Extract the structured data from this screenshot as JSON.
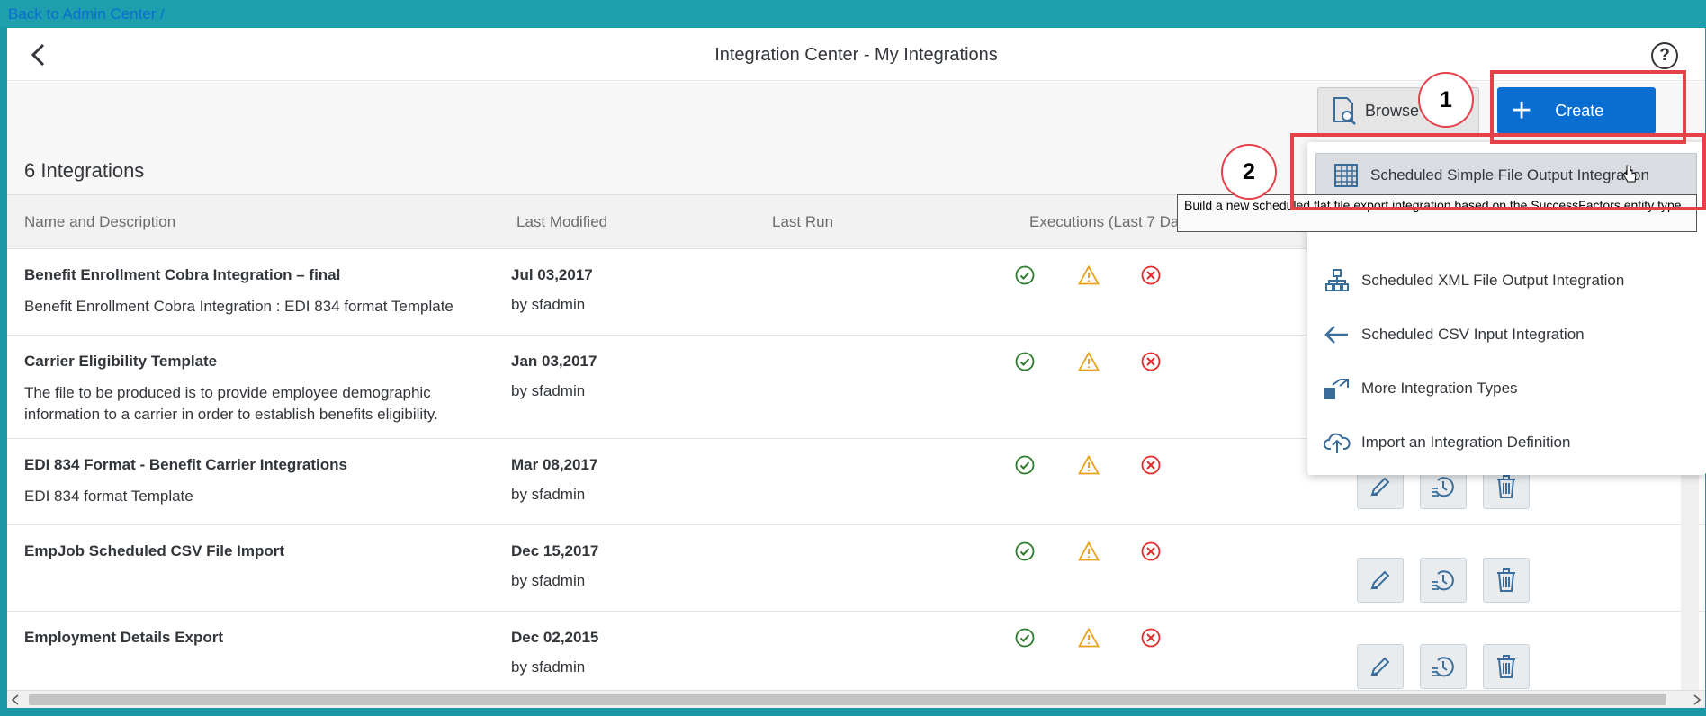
{
  "topbar": {
    "back_link": "Back to Admin Center",
    "separator": "/"
  },
  "header": {
    "title": "Integration Center - My Integrations",
    "help": "?"
  },
  "toolbar": {
    "count": "6 Integrations",
    "browse_label": "Browse C",
    "create_label": "Create"
  },
  "table": {
    "headers": [
      "Name and Description",
      "Last Modified",
      "Last Run",
      "Executions (Last 7 Da"
    ]
  },
  "rows": [
    {
      "name": "Benefit Enrollment Cobra Integration – final",
      "desc": "Benefit Enrollment Cobra Integration : EDI 834 format Template",
      "date": "Jul 03,2017",
      "by": "by sfadmin"
    },
    {
      "name": "Carrier Eligibility Template",
      "desc": "The file to be produced is to provide employee demographic information to a carrier in order to establish benefits eligibility.",
      "date": "Jan 03,2017",
      "by": "by sfadmin"
    },
    {
      "name": "EDI 834 Format - Benefit Carrier Integrations",
      "desc": "EDI 834 format Template",
      "date": "Mar 08,2017",
      "by": "by sfadmin"
    },
    {
      "name": "EmpJob Scheduled CSV File Import",
      "desc": "",
      "date": "Dec 15,2017",
      "by": "by sfadmin"
    },
    {
      "name": "Employment Details Export",
      "desc": "",
      "date": "Dec 02,2015",
      "by": "by sfadmin"
    }
  ],
  "dropdown": {
    "items": [
      {
        "label": "Scheduled Simple File Output Integration",
        "icon": "grid-table-icon"
      },
      {
        "label": "Scheduled XML File Output Integration",
        "icon": "hierarchy-icon"
      },
      {
        "label": "Scheduled CSV Input Integration",
        "icon": "arrow-left-icon"
      },
      {
        "label": "More Integration Types",
        "icon": "open-external-icon"
      },
      {
        "label": "Import an Integration Definition",
        "icon": "cloud-upload-icon"
      }
    ]
  },
  "tooltip": {
    "text": "Build a new scheduled flat file export integration based on the SuccessFactors entity type"
  },
  "markers": {
    "step1": "1",
    "step2": "2"
  },
  "colors": {
    "accent": "#0a6ed1",
    "success": "#2b7d2b",
    "warning": "#e9a117",
    "error": "#e52929",
    "annotation": "#e5414a"
  }
}
